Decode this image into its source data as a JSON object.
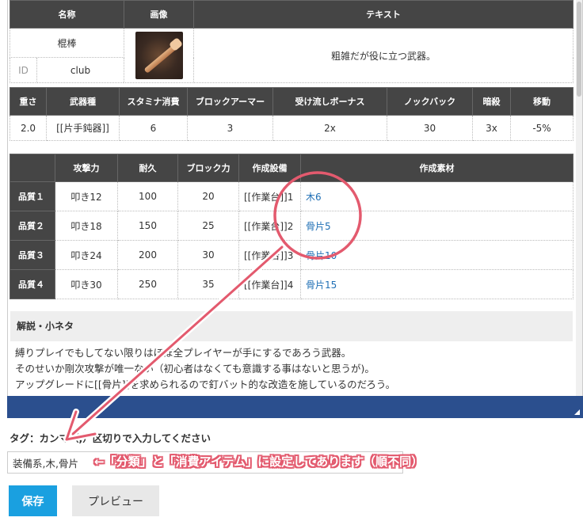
{
  "table1": {
    "headers": [
      "名称",
      "画像",
      "テキスト"
    ],
    "name": "棍棒",
    "id_label": "ID",
    "id_value": "club",
    "text": "粗雑だが役に立つ武器。"
  },
  "table2": {
    "headers": [
      "重さ",
      "武器種",
      "スタミナ消費",
      "ブロックアーマー",
      "受け流しボーナス",
      "ノックバック",
      "暗殺",
      "移動"
    ],
    "values": [
      "2.0",
      "[[片手鈍器]]",
      "6",
      "3",
      "2x",
      "30",
      "3x",
      "-5%"
    ]
  },
  "table3": {
    "headers": [
      "",
      "攻撃力",
      "耐久",
      "ブロック力",
      "作成設備",
      "作成素材"
    ],
    "rows": [
      {
        "quality": "品質１",
        "attack": "叩き12",
        "durability": "100",
        "block": "20",
        "station": "[[作業台]]1",
        "material": "木6"
      },
      {
        "quality": "品質２",
        "attack": "叩き18",
        "durability": "150",
        "block": "25",
        "station": "[[作業台]]2",
        "material": "骨片5"
      },
      {
        "quality": "品質３",
        "attack": "叩き24",
        "durability": "200",
        "block": "30",
        "station": "[[作業台]]3",
        "material": "骨片10"
      },
      {
        "quality": "品質４",
        "attack": "叩き30",
        "durability": "250",
        "block": "35",
        "station": "[[作業台]]4",
        "material": "骨片15"
      }
    ]
  },
  "kaisetsu": {
    "title": "解説・小ネタ",
    "lines": [
      "縛りプレイでもしてない限りはほぼ全プレイヤーが手にするであろう武器。",
      "そのせいか剛次攻撃が唯一ない（初心者はなくても意識する事はないと思うが)。",
      "アップグレードに[[骨片]]を求められるので釘バット的な改造を施しているのだろう。"
    ]
  },
  "tags": {
    "label": "タグ：カンマ（,）区切りで入力してください",
    "value": "装備系,木,骨片"
  },
  "annotation_note": "←「分類」と「消費アイテム」に設定してあります（順不同）",
  "buttons": {
    "save": "保存",
    "preview": "プレビュー"
  },
  "colors": {
    "header_bg": "#454545",
    "link": "#1f6fb5",
    "save_button": "#1aa0e0",
    "annotation": "#e35a6e",
    "footer_bar": "#2b4f8e"
  }
}
